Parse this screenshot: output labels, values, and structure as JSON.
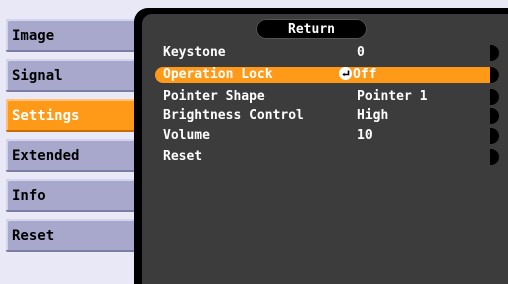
{
  "sidebar": {
    "items": [
      {
        "label": "Image"
      },
      {
        "label": "Signal"
      },
      {
        "label": "Settings"
      },
      {
        "label": "Extended"
      },
      {
        "label": "Info"
      },
      {
        "label": "Reset"
      }
    ],
    "active_index": 2
  },
  "panel": {
    "return_label": "Return",
    "rows": [
      {
        "label": "Keystone",
        "value": "0"
      },
      {
        "label": "Operation Lock",
        "value": "Off"
      },
      {
        "label": "Pointer Shape",
        "value": "Pointer 1"
      },
      {
        "label": "Brightness Control",
        "value": "High"
      },
      {
        "label": "Volume",
        "value": "10"
      },
      {
        "label": "Reset",
        "value": ""
      }
    ],
    "selected_index": 1
  },
  "colors": {
    "accent": "#ff9a18",
    "sidebar_item": "#a8a8cc",
    "panel_bg": "#3c3c3c",
    "page_bg": "#e8e8f6"
  },
  "icons": {
    "enter": "enter-icon"
  }
}
